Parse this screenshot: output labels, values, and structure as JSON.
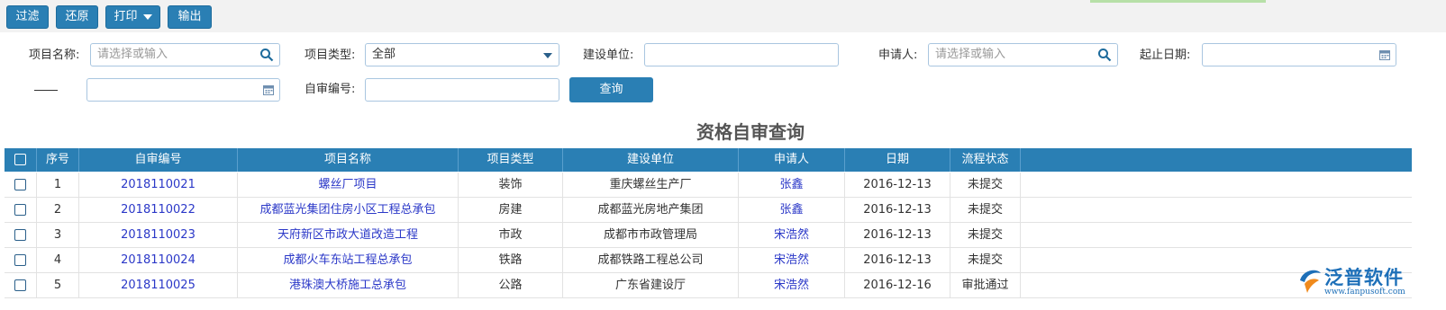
{
  "toolbar": {
    "filter_label": "过滤",
    "reset_label": "还原",
    "print_label": "打印",
    "export_label": "输出"
  },
  "filters": {
    "project_name_label": "项目名称:",
    "project_name_placeholder": "请选择或输入",
    "project_type_label": "项目类型:",
    "project_type_value": "全部",
    "build_unit_label": "建设单位:",
    "applicant_label": "申请人:",
    "applicant_placeholder": "请选择或输入",
    "start_end_date_label": "起止日期:",
    "review_no_label": "自审编号:",
    "query_label": "查询"
  },
  "page_title": "资格自审查询",
  "table": {
    "headers": [
      "序号",
      "自审编号",
      "项目名称",
      "项目类型",
      "建设单位",
      "申请人",
      "日期",
      "流程状态"
    ],
    "rows": [
      {
        "no": "1",
        "code": "2018110021",
        "name": "螺丝厂项目",
        "type": "装饰",
        "unit": "重庆螺丝生产厂",
        "applicant": "张鑫",
        "date": "2016-12-13",
        "status": "未提交"
      },
      {
        "no": "2",
        "code": "2018110022",
        "name": "成都蓝光集团住房小区工程总承包",
        "type": "房建",
        "unit": "成都蓝光房地产集团",
        "applicant": "张鑫",
        "date": "2016-12-13",
        "status": "未提交"
      },
      {
        "no": "3",
        "code": "2018110023",
        "name": "天府新区市政大道改造工程",
        "type": "市政",
        "unit": "成都市市政管理局",
        "applicant": "宋浩然",
        "date": "2016-12-13",
        "status": "未提交"
      },
      {
        "no": "4",
        "code": "2018110024",
        "name": "成都火车东站工程总承包",
        "type": "铁路",
        "unit": "成都铁路工程总公司",
        "applicant": "宋浩然",
        "date": "2016-12-13",
        "status": "未提交"
      },
      {
        "no": "5",
        "code": "2018110025",
        "name": "港珠澳大桥施工总承包",
        "type": "公路",
        "unit": "广东省建设厅",
        "applicant": "宋浩然",
        "date": "2016-12-16",
        "status": "审批通过"
      }
    ]
  },
  "logo": {
    "brand": "泛普软件",
    "url": "www.fanpusoft.com"
  },
  "colors": {
    "accent": "#2a7fb4",
    "link": "#2b38c8"
  },
  "icons": [
    "search-icon",
    "calendar-icon",
    "dropdown-arrow-icon",
    "checkbox-icon",
    "fanpu-logo-icon"
  ]
}
